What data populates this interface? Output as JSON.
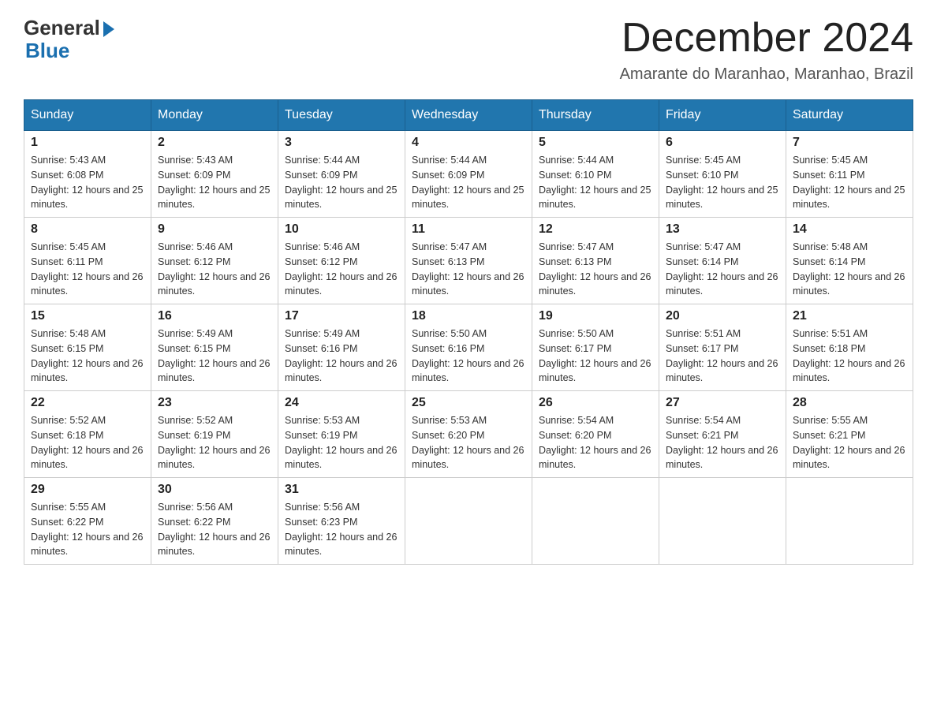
{
  "header": {
    "logo_general": "General",
    "logo_blue": "Blue",
    "title": "December 2024",
    "location": "Amarante do Maranhao, Maranhao, Brazil"
  },
  "calendar": {
    "weekdays": [
      "Sunday",
      "Monday",
      "Tuesday",
      "Wednesday",
      "Thursday",
      "Friday",
      "Saturday"
    ],
    "weeks": [
      [
        {
          "day": "1",
          "sunrise": "5:43 AM",
          "sunset": "6:08 PM",
          "daylight": "12 hours and 25 minutes."
        },
        {
          "day": "2",
          "sunrise": "5:43 AM",
          "sunset": "6:09 PM",
          "daylight": "12 hours and 25 minutes."
        },
        {
          "day": "3",
          "sunrise": "5:44 AM",
          "sunset": "6:09 PM",
          "daylight": "12 hours and 25 minutes."
        },
        {
          "day": "4",
          "sunrise": "5:44 AM",
          "sunset": "6:09 PM",
          "daylight": "12 hours and 25 minutes."
        },
        {
          "day": "5",
          "sunrise": "5:44 AM",
          "sunset": "6:10 PM",
          "daylight": "12 hours and 25 minutes."
        },
        {
          "day": "6",
          "sunrise": "5:45 AM",
          "sunset": "6:10 PM",
          "daylight": "12 hours and 25 minutes."
        },
        {
          "day": "7",
          "sunrise": "5:45 AM",
          "sunset": "6:11 PM",
          "daylight": "12 hours and 25 minutes."
        }
      ],
      [
        {
          "day": "8",
          "sunrise": "5:45 AM",
          "sunset": "6:11 PM",
          "daylight": "12 hours and 26 minutes."
        },
        {
          "day": "9",
          "sunrise": "5:46 AM",
          "sunset": "6:12 PM",
          "daylight": "12 hours and 26 minutes."
        },
        {
          "day": "10",
          "sunrise": "5:46 AM",
          "sunset": "6:12 PM",
          "daylight": "12 hours and 26 minutes."
        },
        {
          "day": "11",
          "sunrise": "5:47 AM",
          "sunset": "6:13 PM",
          "daylight": "12 hours and 26 minutes."
        },
        {
          "day": "12",
          "sunrise": "5:47 AM",
          "sunset": "6:13 PM",
          "daylight": "12 hours and 26 minutes."
        },
        {
          "day": "13",
          "sunrise": "5:47 AM",
          "sunset": "6:14 PM",
          "daylight": "12 hours and 26 minutes."
        },
        {
          "day": "14",
          "sunrise": "5:48 AM",
          "sunset": "6:14 PM",
          "daylight": "12 hours and 26 minutes."
        }
      ],
      [
        {
          "day": "15",
          "sunrise": "5:48 AM",
          "sunset": "6:15 PM",
          "daylight": "12 hours and 26 minutes."
        },
        {
          "day": "16",
          "sunrise": "5:49 AM",
          "sunset": "6:15 PM",
          "daylight": "12 hours and 26 minutes."
        },
        {
          "day": "17",
          "sunrise": "5:49 AM",
          "sunset": "6:16 PM",
          "daylight": "12 hours and 26 minutes."
        },
        {
          "day": "18",
          "sunrise": "5:50 AM",
          "sunset": "6:16 PM",
          "daylight": "12 hours and 26 minutes."
        },
        {
          "day": "19",
          "sunrise": "5:50 AM",
          "sunset": "6:17 PM",
          "daylight": "12 hours and 26 minutes."
        },
        {
          "day": "20",
          "sunrise": "5:51 AM",
          "sunset": "6:17 PM",
          "daylight": "12 hours and 26 minutes."
        },
        {
          "day": "21",
          "sunrise": "5:51 AM",
          "sunset": "6:18 PM",
          "daylight": "12 hours and 26 minutes."
        }
      ],
      [
        {
          "day": "22",
          "sunrise": "5:52 AM",
          "sunset": "6:18 PM",
          "daylight": "12 hours and 26 minutes."
        },
        {
          "day": "23",
          "sunrise": "5:52 AM",
          "sunset": "6:19 PM",
          "daylight": "12 hours and 26 minutes."
        },
        {
          "day": "24",
          "sunrise": "5:53 AM",
          "sunset": "6:19 PM",
          "daylight": "12 hours and 26 minutes."
        },
        {
          "day": "25",
          "sunrise": "5:53 AM",
          "sunset": "6:20 PM",
          "daylight": "12 hours and 26 minutes."
        },
        {
          "day": "26",
          "sunrise": "5:54 AM",
          "sunset": "6:20 PM",
          "daylight": "12 hours and 26 minutes."
        },
        {
          "day": "27",
          "sunrise": "5:54 AM",
          "sunset": "6:21 PM",
          "daylight": "12 hours and 26 minutes."
        },
        {
          "day": "28",
          "sunrise": "5:55 AM",
          "sunset": "6:21 PM",
          "daylight": "12 hours and 26 minutes."
        }
      ],
      [
        {
          "day": "29",
          "sunrise": "5:55 AM",
          "sunset": "6:22 PM",
          "daylight": "12 hours and 26 minutes."
        },
        {
          "day": "30",
          "sunrise": "5:56 AM",
          "sunset": "6:22 PM",
          "daylight": "12 hours and 26 minutes."
        },
        {
          "day": "31",
          "sunrise": "5:56 AM",
          "sunset": "6:23 PM",
          "daylight": "12 hours and 26 minutes."
        },
        null,
        null,
        null,
        null
      ]
    ]
  }
}
